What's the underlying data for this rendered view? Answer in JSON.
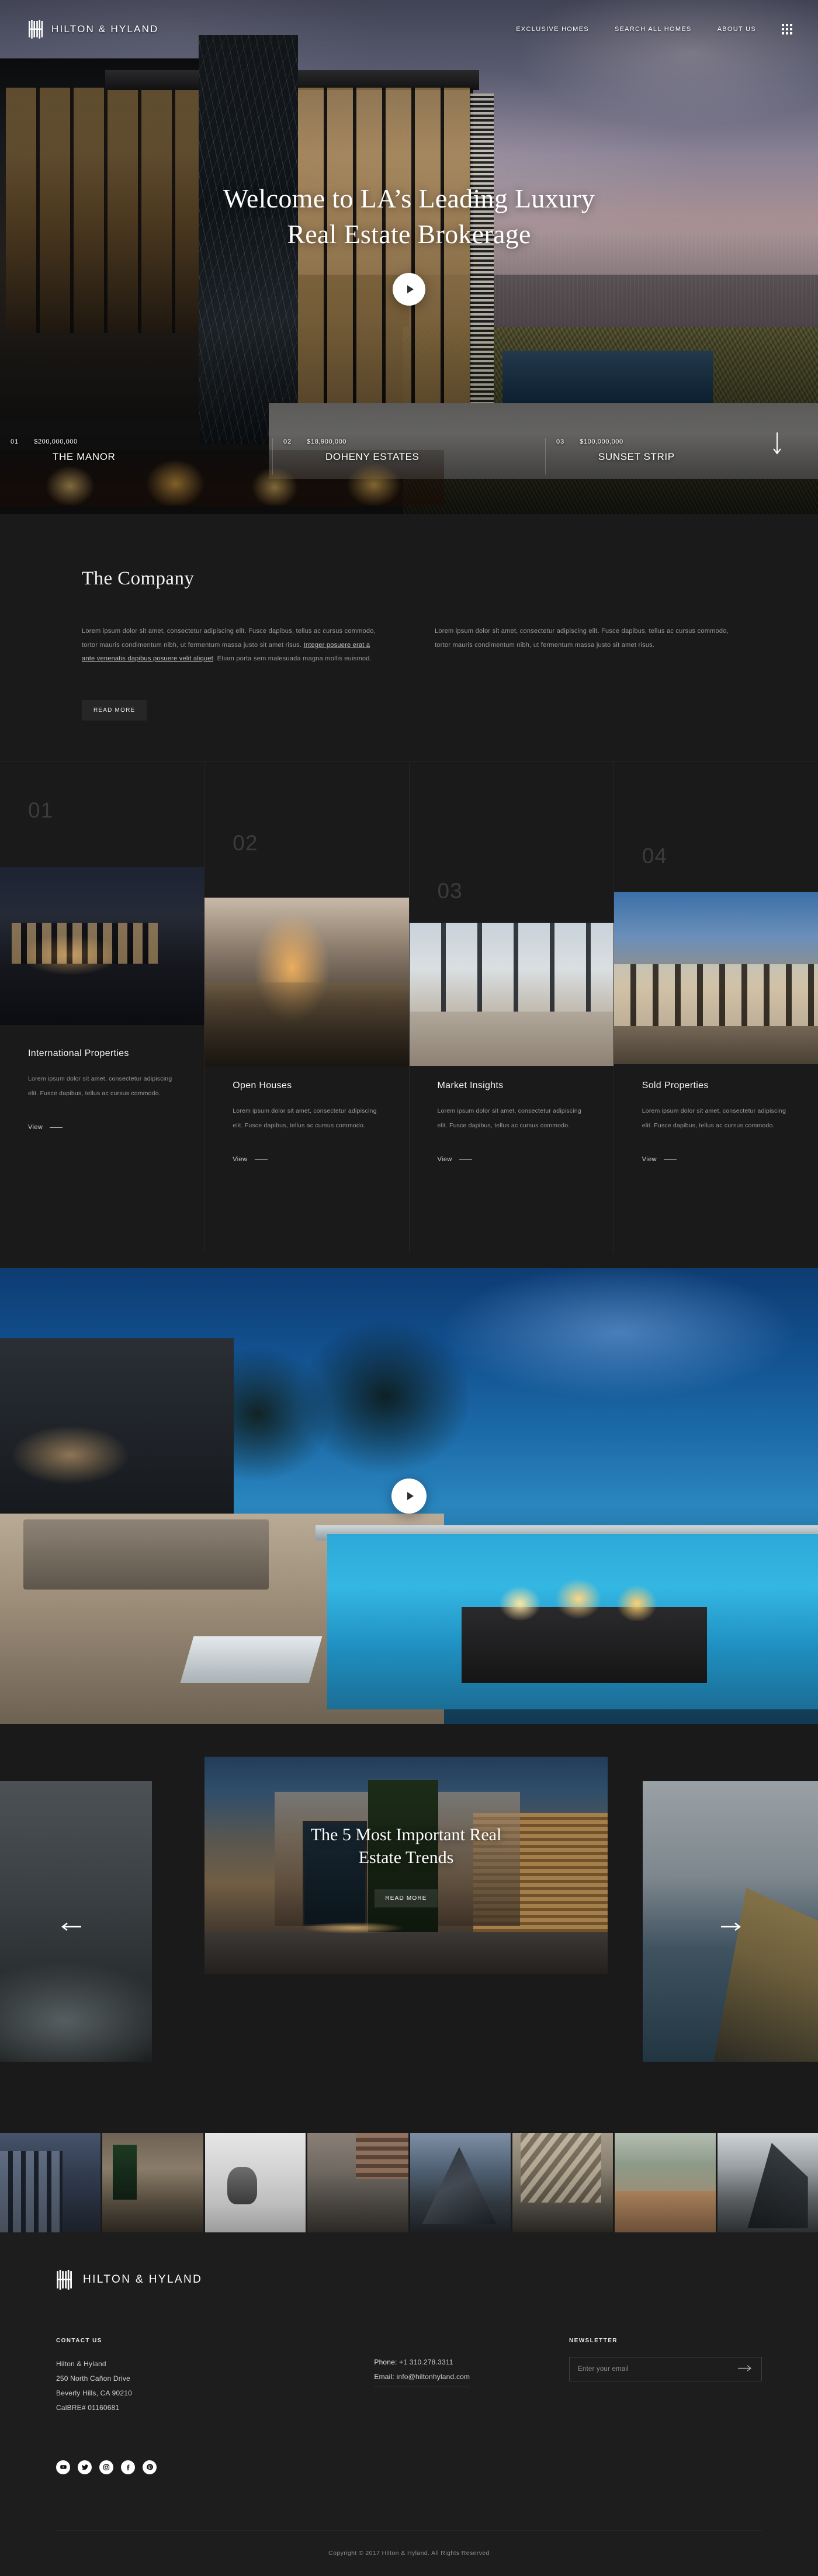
{
  "brand": {
    "name": "HILTON & HYLAND",
    "logo_icon": "hh-monogram-icon"
  },
  "header": {
    "nav": [
      {
        "label": "EXCLUSIVE HOMES"
      },
      {
        "label": "SEARCH ALL HOMES"
      },
      {
        "label": "ABOUT US"
      }
    ],
    "menu_icon": "grid-dots-menu-icon"
  },
  "hero": {
    "title_line1": "Welcome to LA’s Leading Luxury",
    "title_line2": "Real Estate Brokerage",
    "play_icon": "play-icon",
    "scroll_icon": "arrow-down-icon",
    "properties": [
      {
        "num": "01",
        "price": "$200,000,000",
        "name": "THE MANOR"
      },
      {
        "num": "02",
        "price": "$18,900,000",
        "name": "DOHENY ESTATES"
      },
      {
        "num": "03",
        "price": "$100,000,000",
        "name": "SUNSET STRIP"
      }
    ]
  },
  "company": {
    "title": "The Company",
    "col1_part1": "Lorem ipsum dolor sit amet, consectetur adipiscing elit. Fusce dapibus, tellus ac cursus commodo, tortor mauris condimentum nibh, ut fermentum massa justo sit amet risus. ",
    "col1_link": "Integer posuere erat a ante venenatis dapibus posuere velit aliquet",
    "col1_part2": ". Etiam porta sem malesuada magna mollis euismod.",
    "col2": "Lorem ipsum dolor sit amet, consectetur adipiscing elit. Fusce dapibus, tellus ac cursus commodo, tortor mauris condimentum nibh, ut fermentum massa justo sit amet risus.",
    "read_more": "READ MORE"
  },
  "categories": [
    {
      "num": "01",
      "title": "International Properties",
      "text": "Lorem ipsum dolor sit amet, consectetur adipiscing elit. Fusce dapibus, tellus ac cursus commodo.",
      "view": "View",
      "image_name": "night-modern-house-photo"
    },
    {
      "num": "02",
      "title": "Open Houses",
      "text": "Lorem ipsum dolor sit amet, consectetur adipiscing elit. Fusce dapibus, tellus ac cursus commodo.",
      "view": "View",
      "image_name": "lit-corridor-entry-photo"
    },
    {
      "num": "03",
      "title": "Market Insights",
      "text": "Lorem ipsum dolor sit amet, consectetur adipiscing elit. Fusce dapibus, tellus ac cursus commodo.",
      "view": "View",
      "image_name": "living-room-city-view-photo"
    },
    {
      "num": "04",
      "title": "Sold Properties",
      "text": "Lorem ipsum dolor sit amet, consectetur adipiscing elit. Fusce dapibus, tellus ac cursus commodo.",
      "view": "View",
      "image_name": "hillside-villa-dusk-photo"
    }
  ],
  "video_band": {
    "play_icon": "play-icon",
    "image_name": "infinity-pool-terrace-night-photo"
  },
  "blog": {
    "prev_icon": "arrow-left-icon",
    "next_icon": "arrow-right-icon",
    "featured": {
      "title_line1": "The 5 Most Important Real",
      "title_line2": "Estate Trends",
      "read_more": "READ MORE",
      "image_name": "modern-home-entry-dusk-photo"
    },
    "prev_card_image": "misty-mountain-photo",
    "next_card_image": "coastal-cliff-ocean-photo"
  },
  "gallery": {
    "thumbs": [
      {
        "image_name": "apartment-exterior-thumb"
      },
      {
        "image_name": "bedroom-interior-thumb"
      },
      {
        "image_name": "kitchen-sink-vase-thumb"
      },
      {
        "image_name": "brick-kitchen-thumb"
      },
      {
        "image_name": "a-frame-cabin-snow-thumb"
      },
      {
        "image_name": "wood-beam-interior-thumb"
      },
      {
        "image_name": "mountain-view-kitchen-thumb"
      },
      {
        "image_name": "angular-architecture-thumb"
      }
    ]
  },
  "footer": {
    "brand_name": "HILTON & HYLAND",
    "contact_label": "CONTACT US",
    "address": [
      "Hilton & Hyland",
      "250 North Cañon Drive",
      "Beverly Hills, CA 90210",
      "CalBRE# 01160681"
    ],
    "phone_key": "Phone:",
    "phone_value": "+1 310.278.3311",
    "email_key": "Email:",
    "email_value": "info@hiltonhyland.com",
    "newsletter_label": "NEWSLETTER",
    "newsletter_placeholder": "Enter your email",
    "newsletter_value": "",
    "newsletter_submit_icon": "arrow-right-icon",
    "socials": [
      {
        "name": "youtube-icon"
      },
      {
        "name": "twitter-icon"
      },
      {
        "name": "instagram-icon"
      },
      {
        "name": "facebook-icon"
      },
      {
        "name": "pinterest-icon"
      }
    ],
    "copyright": "Copyright © 2017 Hilton & Hyland. All Rights Reserved"
  },
  "colors": {
    "background": "#1a1a1a",
    "footer_background": "#1d1d1d",
    "text_primary": "#ffffff",
    "text_muted": "#9b9b9b",
    "accent_number": "#3b3b3b"
  }
}
